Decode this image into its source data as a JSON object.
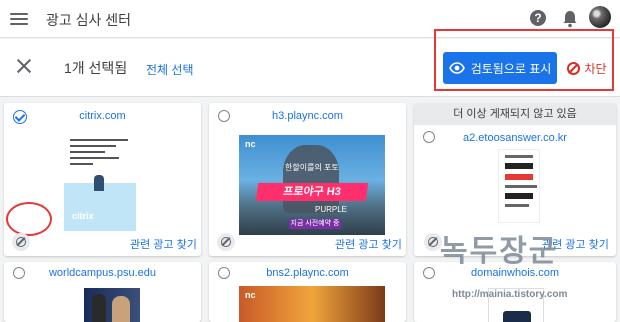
{
  "header": {
    "title": "광고 심사 센터"
  },
  "actionbar": {
    "selected_count": "1개 선택됨",
    "select_all": "전체 선택",
    "review_label": "검토됨으로 표시",
    "block_label": "차단"
  },
  "cards": [
    {
      "domain": "citrix.com",
      "related": "관련 광고 찾기",
      "selected": true,
      "ad_logo": "citrix"
    },
    {
      "domain": "h3.plaync.com",
      "related": "관련 광고 찾기",
      "selected": false,
      "ad": {
        "brand": "nc",
        "caption": "한할이를의 포토",
        "headline": "프로야구 H3",
        "sub": "PURPLE",
        "cta": "지금 사전예약 중"
      }
    },
    {
      "domain": "a2.etoosanswer.co.kr",
      "related": "관련 광고 찾기",
      "selected": false,
      "notice": "더 이상 게재되지 않고 있음"
    },
    {
      "domain": "worldcampus.psu.edu",
      "selected": false
    },
    {
      "domain": "bns2.plaync.com",
      "selected": false,
      "ad_brand": "nc"
    },
    {
      "domain": "domainwhois.com",
      "selected": false
    }
  ],
  "watermark": {
    "text": "녹두장군",
    "url": "http://mainia.tistory.com"
  },
  "colors": {
    "accent": "#1a73e8",
    "danger": "#d93025",
    "highlight": "#e53935"
  }
}
